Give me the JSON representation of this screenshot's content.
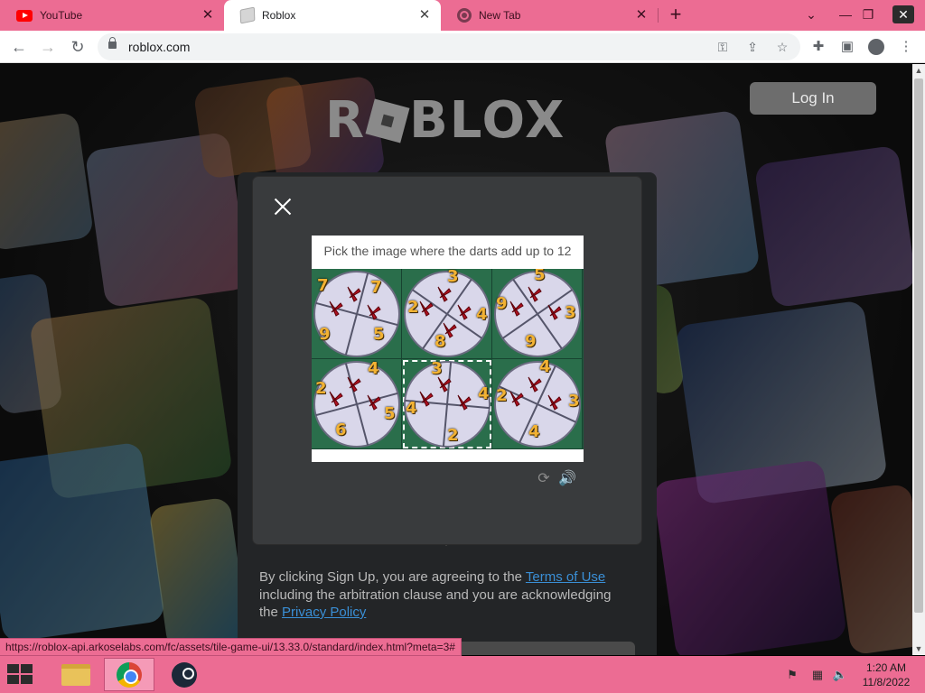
{
  "browser": {
    "tabs": [
      {
        "label": "YouTube",
        "favicon": "youtube-icon"
      },
      {
        "label": "Roblox",
        "favicon": "roblox-icon",
        "active": true
      },
      {
        "label": "New Tab",
        "favicon": "chrome-icon"
      }
    ],
    "new_tab_symbol": "+",
    "window_controls": {
      "minimize": "⌄",
      "restore": "❐",
      "close": "✕"
    },
    "url": "roblox.com",
    "status_url": "https://roblox-api.arkoselabs.com/fc/assets/tile-game-ui/13.33.0/standard/index.html?meta=3#"
  },
  "page": {
    "logo_text": "ROBLOX",
    "login_label": "Log In",
    "legal": {
      "prefix": "By clicking Sign Up, you are agreeing to the ",
      "terms_link": "Terms of Use",
      "middle": " including the arbitration clause and you are acknowledging the ",
      "privacy_link": "Privacy Policy"
    }
  },
  "captcha": {
    "prompt": "Pick the image where the darts add up to 12",
    "tiles": [
      {
        "numbers": [
          "7",
          "7",
          "9",
          "5"
        ],
        "darts": 3
      },
      {
        "numbers": [
          "3",
          "2",
          "4",
          "8"
        ],
        "darts": 4
      },
      {
        "numbers": [
          "5",
          "9",
          "3",
          "9"
        ],
        "darts": 3
      },
      {
        "numbers": [
          "2",
          "4",
          "6",
          "5"
        ],
        "darts": 3
      },
      {
        "numbers": [
          "3",
          "4",
          "4",
          "2"
        ],
        "darts": 3,
        "selected": true
      },
      {
        "numbers": [
          "4",
          "2",
          "3",
          "4"
        ],
        "darts": 3
      }
    ],
    "icons": [
      "reload-icon",
      "audio-icon"
    ]
  },
  "taskbar": {
    "apps": [
      "file-explorer-icon",
      "chrome-icon",
      "steam-icon"
    ],
    "active_app": "chrome-icon",
    "time": "1:20 AM",
    "date": "11/8/2022"
  },
  "colors": {
    "accent_pink": "#ec6c93",
    "modal_bg": "#393b3d",
    "link_blue": "#3a8fd6",
    "dart_number": "#f2b233"
  }
}
